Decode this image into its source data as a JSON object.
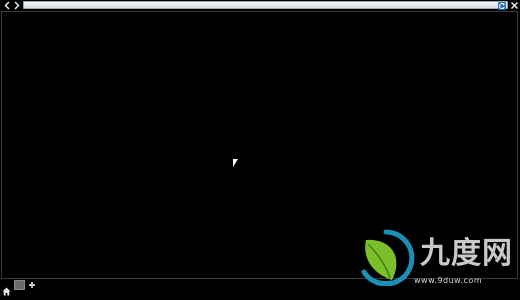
{
  "toolbar": {
    "back_icon": "chevron-left-icon",
    "forward_icon": "chevron-right-icon",
    "url_value": "",
    "reload_icon": "reload-icon",
    "close_icon": "close-icon"
  },
  "bottombar": {
    "home_icon": "home-icon",
    "tab_icon": "tab-icon",
    "add_icon": "plus-icon"
  },
  "watermark": {
    "brand": "九度网",
    "url": "www.9duw.com"
  },
  "colors": {
    "background": "#000000",
    "url_bar": "#dfe5ea",
    "accent": "#2f6fb5",
    "watermark_green": "#7bbf2a"
  }
}
